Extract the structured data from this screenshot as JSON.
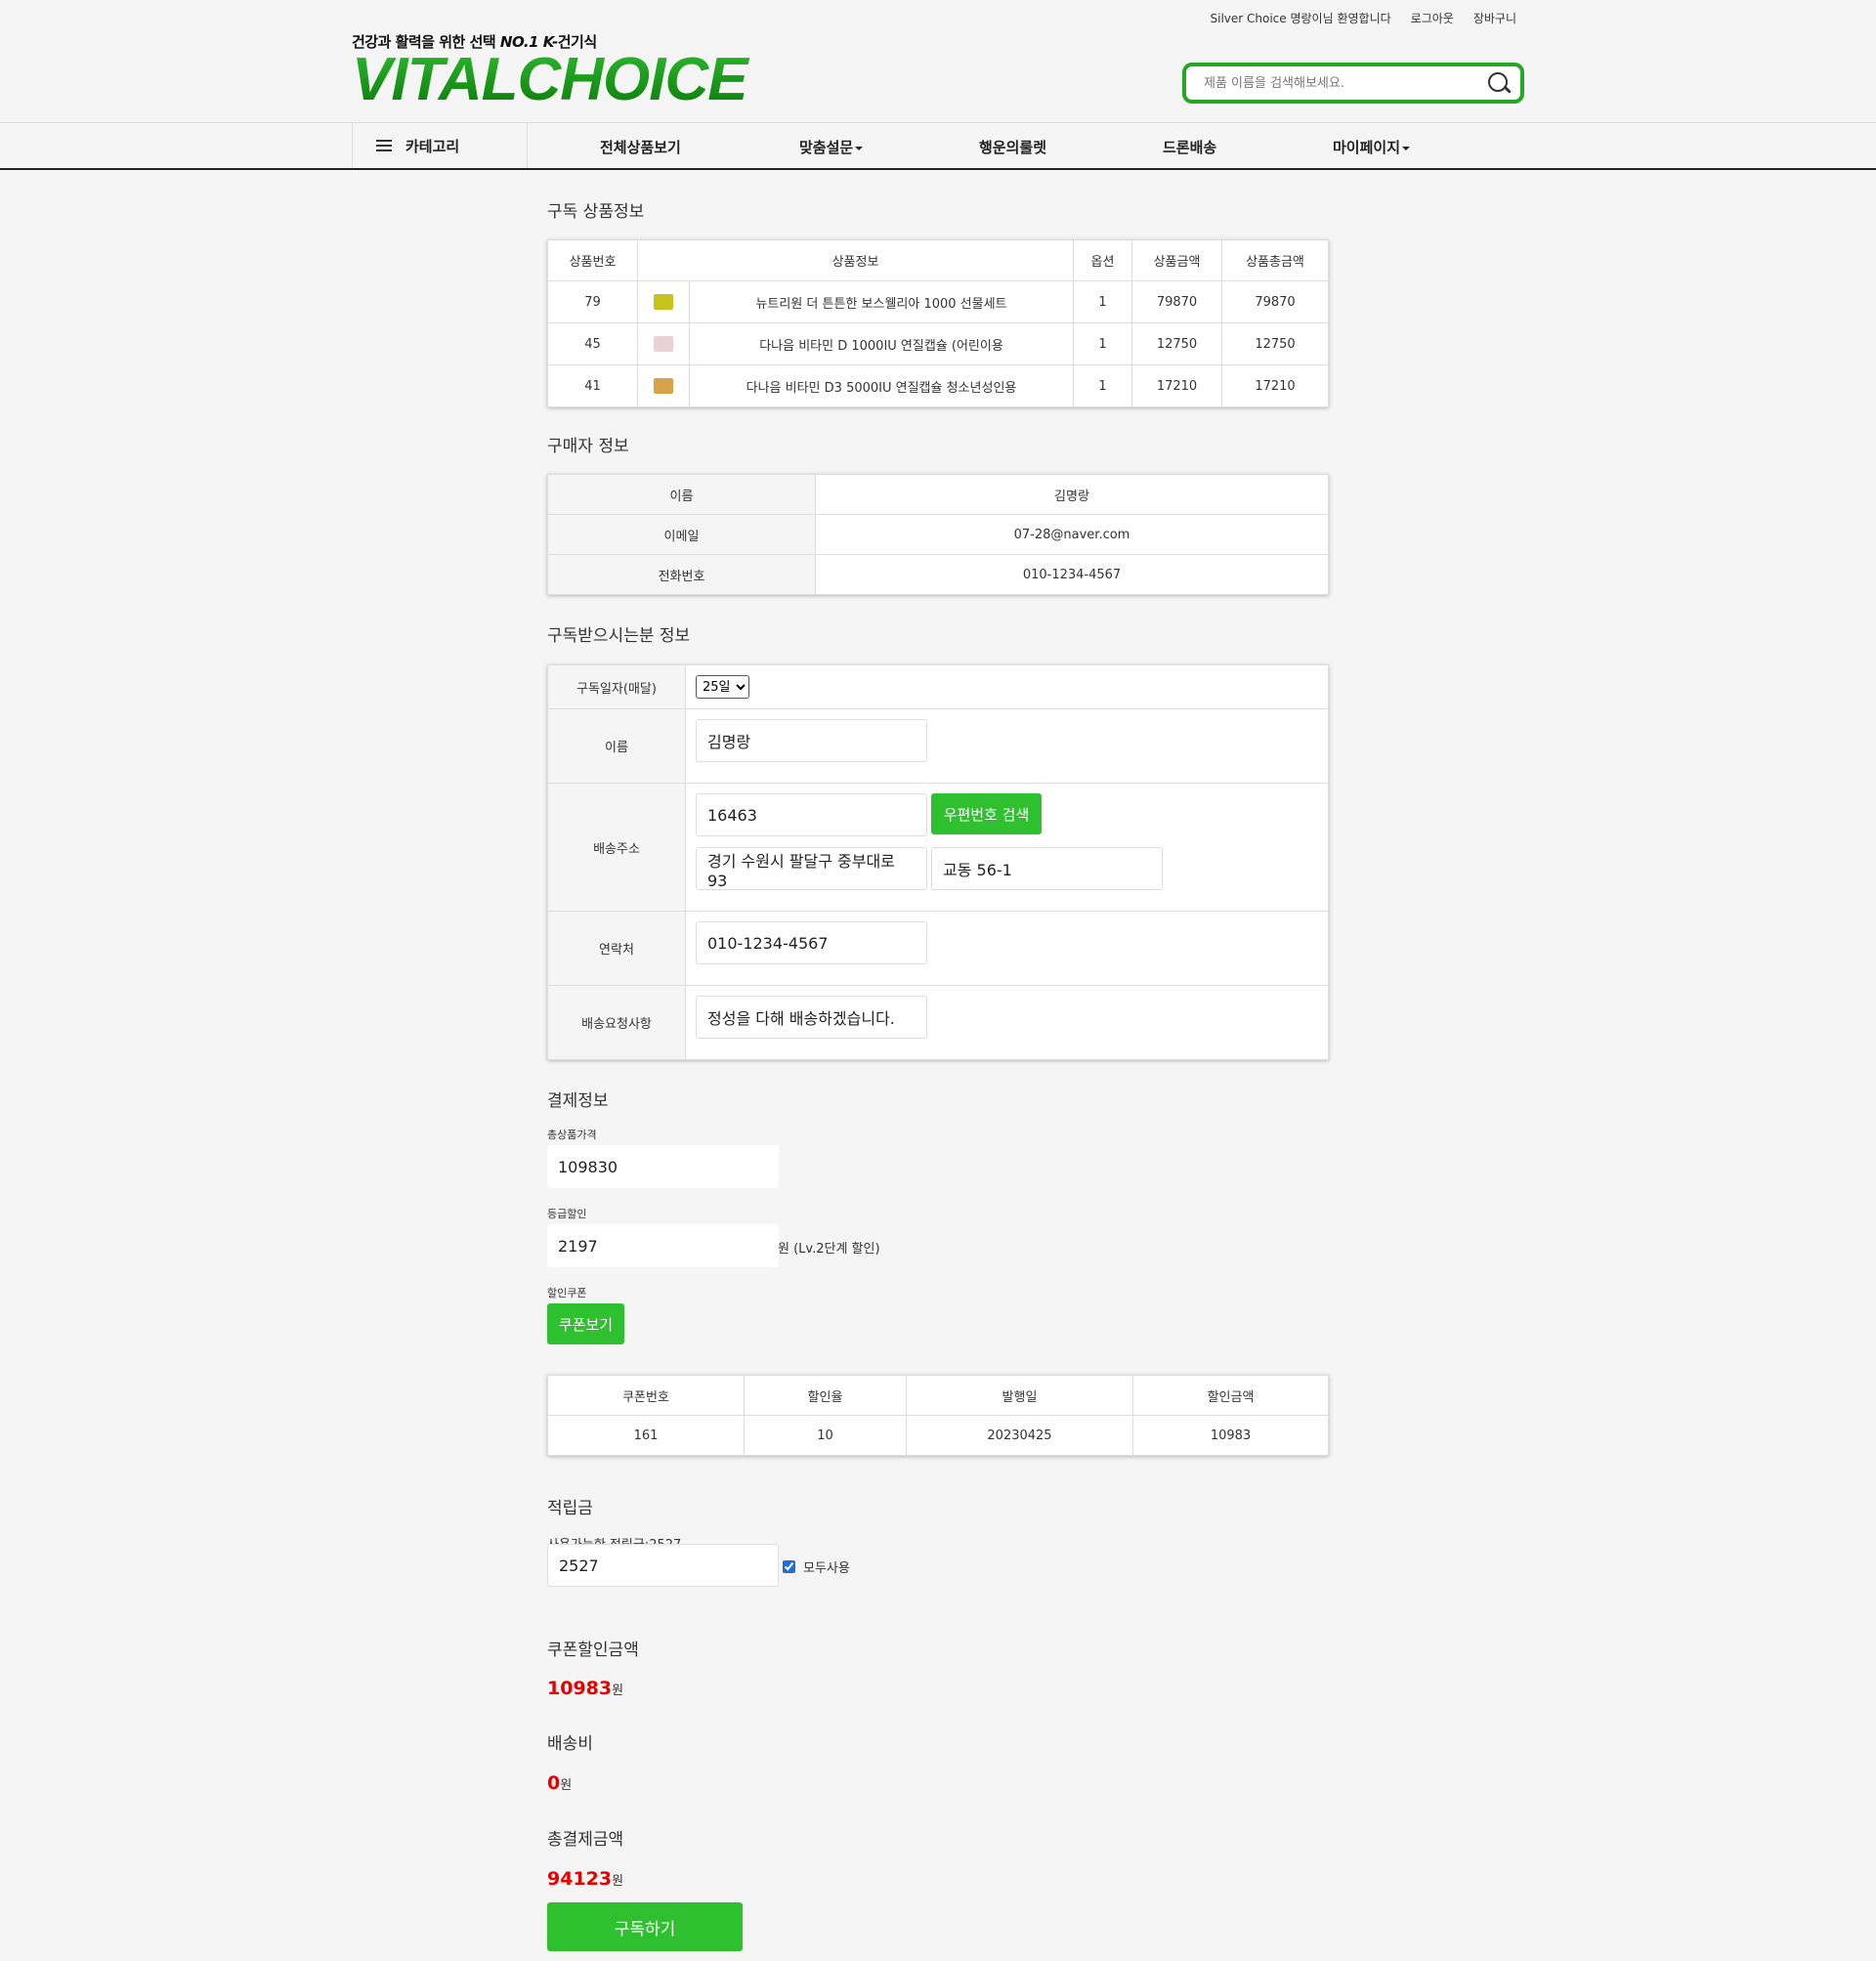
{
  "header": {
    "top_links": {
      "welcome": "Silver Choice 명랑이님 환영합니다",
      "logout": "로그아웃",
      "cart": "장바구니"
    },
    "logo": {
      "tagline_prefix": "건강과 활력을 위한 선택",
      "tagline_em": "NO.1 K-",
      "tagline_suffix": "건기식",
      "brand": "VITALCHOICE"
    },
    "search": {
      "placeholder": "제품 이름을 검색해보세요."
    }
  },
  "nav": {
    "category": "카테고리",
    "items": [
      "전체상품보기",
      "맞춤설문",
      "행운의룰렛",
      "드론배송",
      "마이페이지"
    ]
  },
  "products": {
    "title": "구독 상품정보",
    "headers": [
      "상품번호",
      "상품정보",
      "옵션",
      "상품금액",
      "상품총금액"
    ],
    "rows": [
      {
        "no": "79",
        "name": "뉴트리원 더 튼튼한 보스웰리아 1000 선물세트",
        "option": "1",
        "price": "79870",
        "total": "79870",
        "thumb_color": "#c8c21e"
      },
      {
        "no": "45",
        "name": "다나음 비타민 D 1000IU 연질캡슐 (어린이용",
        "option": "1",
        "price": "12750",
        "total": "12750",
        "thumb_color": "#e8c8cc"
      },
      {
        "no": "41",
        "name": "다나음 비타민 D3 5000IU 연질캡슐 청소년성인용",
        "option": "1",
        "price": "17210",
        "total": "17210",
        "thumb_color": "#d9a24a"
      }
    ]
  },
  "buyer": {
    "title": "구매자 정보",
    "rows": [
      {
        "label": "이름",
        "value": "김명랑"
      },
      {
        "label": "이메일",
        "value": "07-28@naver.com"
      },
      {
        "label": "전화번호",
        "value": "010-1234-4567"
      }
    ]
  },
  "recipient": {
    "title": "구독받으시는분 정보",
    "day_label": "구독일자(매달)",
    "day_value": "25일",
    "name_label": "이름",
    "name_value": "김명랑",
    "address_label": "배송주소",
    "zipcode": "16463",
    "zip_search_button": "우편번호 검색",
    "address1": "경기 수원시 팔달구 중부대로 93",
    "address2": "교동 56-1",
    "phone_label": "연락처",
    "phone_value": "010-1234-4567",
    "request_label": "배송요청사항",
    "request_value": "정성을 다해 배송하겠습니다."
  },
  "payment": {
    "title": "결제정보",
    "total_label": "총상품가격",
    "total_value": "109830",
    "grade_label": "등급할인",
    "grade_value": "2197",
    "grade_note": "원 (Lv.2단계 할인)",
    "coupon_label": "할인쿠폰",
    "coupon_button": "쿠폰보기",
    "coupon_headers": [
      "쿠폰번호",
      "할인율",
      "발행일",
      "할인금액"
    ],
    "coupon_row": [
      "161",
      "10",
      "20230425",
      "10983"
    ]
  },
  "points": {
    "title": "적립금",
    "available": "사용가능한 적립금:2527",
    "value": "2527",
    "use_all_label": "모두사용",
    "use_all_checked": true
  },
  "summary": {
    "coupon_title": "쿠폰할인금액",
    "coupon_amount": "10983",
    "shipping_title": "배송비",
    "shipping_amount": "0",
    "total_title": "총결제금액",
    "total_amount": "94123",
    "currency": "원",
    "subscribe_button": "구독하기"
  },
  "colors": {
    "accent": "#2fc02f",
    "highlight": "#e60000",
    "brand": "#1a9a1a"
  }
}
